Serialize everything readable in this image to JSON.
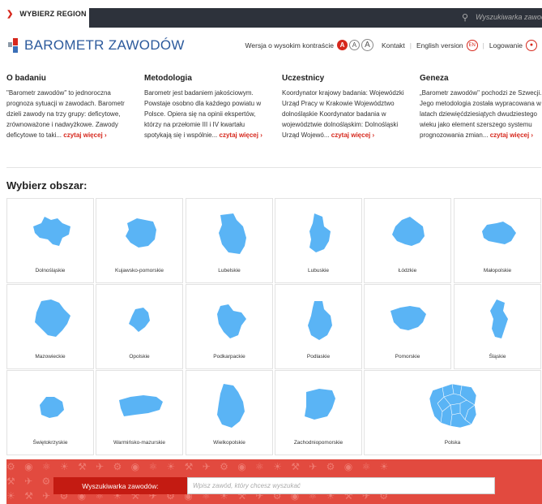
{
  "topbar": {
    "region_label": "WYBIERZ REGION",
    "search_placeholder": "Wyszukiwarka zawodów"
  },
  "header": {
    "logo_text": "BAROMETR ZAWODÓW",
    "contrast_label": "Wersja o wysokim kontraście",
    "contrast_options": [
      "A",
      "A",
      "A"
    ],
    "contact": "Kontakt",
    "english": "English version",
    "english_badge": "EN",
    "login": "Logowanie"
  },
  "info": [
    {
      "title": "O badaniu",
      "text": "\"Barometr zawodów\" to jednoroczna prognoza sytuacji w zawodach. Barometr dzieli zawody na trzy grupy: deficytowe, zrównoważone i nadwyżkowe. Zawody deficytowe to taki...",
      "more": "czytaj więcej ›"
    },
    {
      "title": "Metodologia",
      "text": "Barometr jest badaniem jakościowym. Powstaje osobno dla każdego powiatu w Polsce. Opiera się na opinii ekspertów, którzy na przełomie III i IV kwartału spotykają się i wspólnie...",
      "more": "czytaj więcej ›"
    },
    {
      "title": "Uczestnicy",
      "text": "Koordynator krajowy badania: Wojewódzki Urząd Pracy w Krakowie Województwo dolnośląskie Koordynator badania w województwie dolnośląskim: Dolnośląski Urząd Wojewó...",
      "more": "czytaj więcej ›"
    },
    {
      "title": "Geneza",
      "text": "„Barometr zawodów\" pochodzi ze Szwecji. Jego metodologia została wypracowana w latach dziewięćdziesiątych dwudziestego wieku jako element szerszego systemu prognozowania zmian...",
      "more": "czytaj więcej ›"
    }
  ],
  "section_title": "Wybierz obszar:",
  "regions": [
    "Dolnośląskie",
    "Kujawsko-pomorskie",
    "Lubelskie",
    "Lubuskie",
    "Łódzkie",
    "Małopolskie",
    "Mazowieckie",
    "Opolskie",
    "Podkarpackie",
    "Podlaskie",
    "Pomorskie",
    "Śląskie",
    "Świętokrzyskie",
    "Warmińsko-mazurskie",
    "Wielkopolskie",
    "Zachodniopomorskie",
    "Polska"
  ],
  "colors": {
    "accent": "#d6271c",
    "map_fill": "#5ab4f5",
    "topbar": "#2d323b",
    "footer": "#e24a3f"
  },
  "footer": {
    "search_label": "Wyszukiwarka zawodów:",
    "search_placeholder": "Wpisz zawód, który chcesz wyszukać"
  }
}
